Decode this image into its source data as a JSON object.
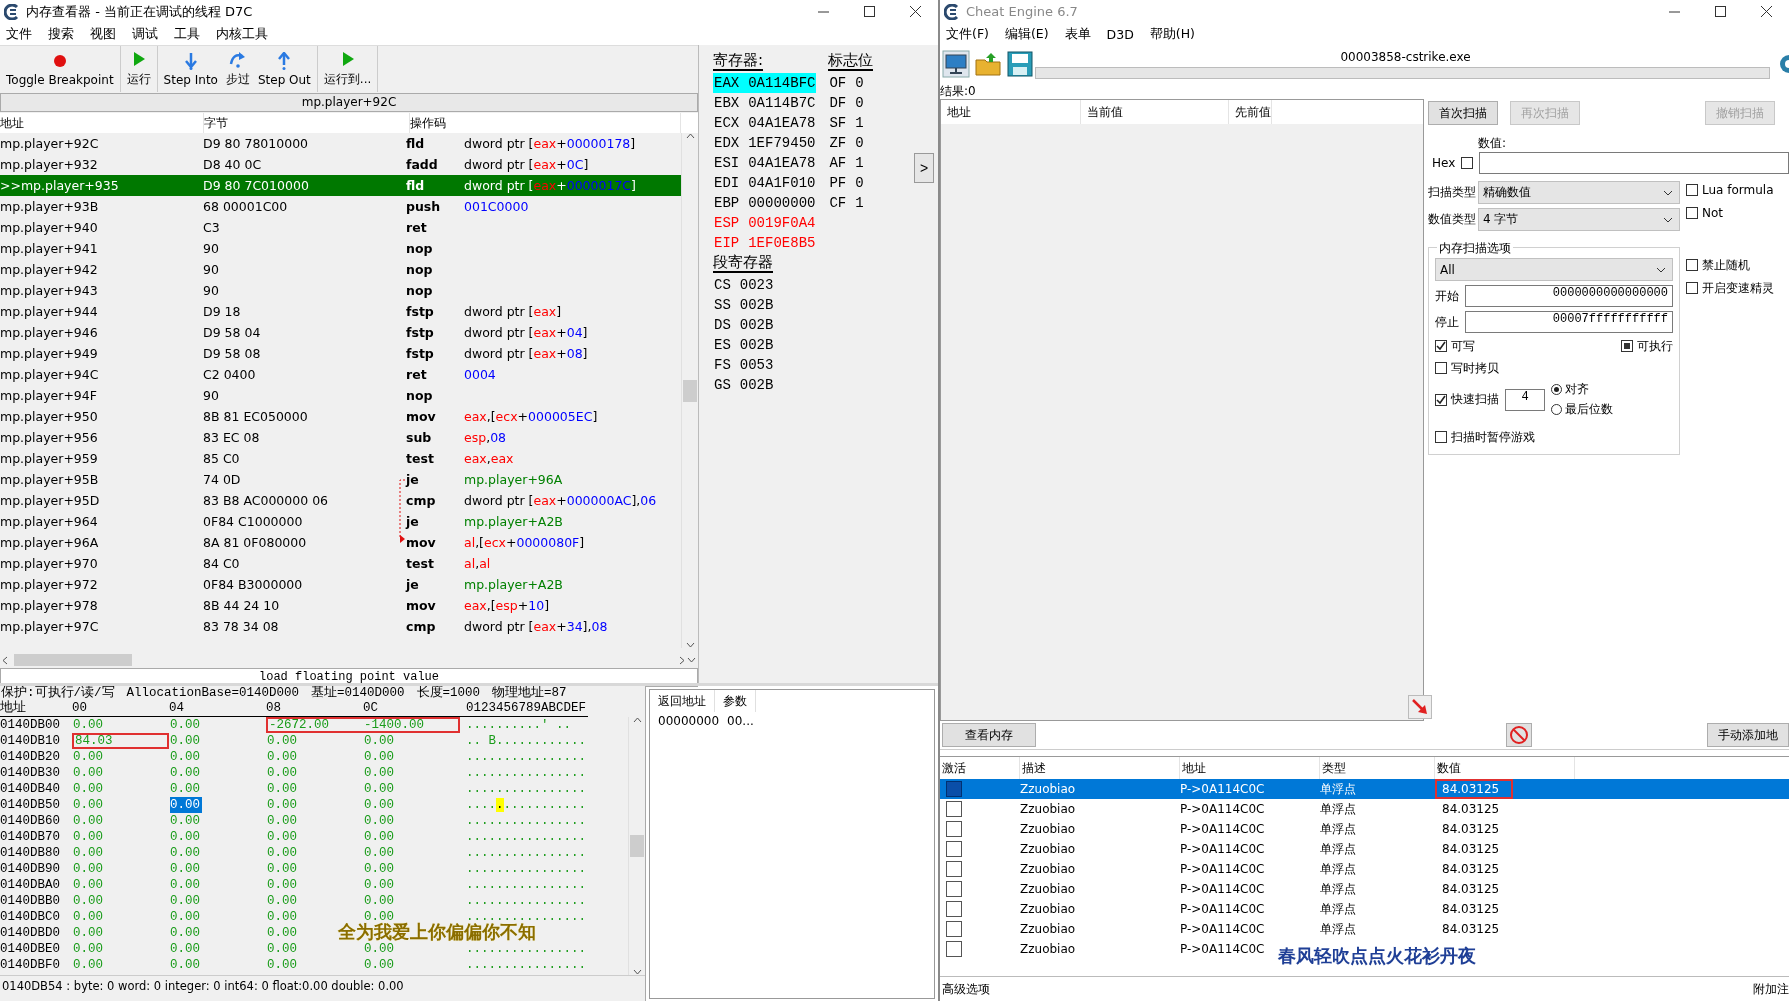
{
  "memory_viewer": {
    "title": "内存查看器 - 当前正在调试的线程 D7C",
    "menu": [
      "文件",
      "搜索",
      "视图",
      "调试",
      "工具",
      "内核工具"
    ],
    "toolbar": [
      [
        {
          "label": "Toggle Breakpoint",
          "kind": "breakpoint"
        }
      ],
      [
        {
          "label": "运行",
          "kind": "run"
        }
      ],
      [
        {
          "label": "Step Into",
          "kind": "step_into"
        },
        {
          "label": "步过",
          "kind": "step_over"
        },
        {
          "label": "Step Out",
          "kind": "step_out"
        }
      ],
      [
        {
          "label": "运行到...",
          "kind": "run"
        }
      ]
    ],
    "address_bar": "mp.player+92C",
    "disassembly": {
      "columns": [
        "地址",
        "字节",
        "操作码"
      ],
      "rows": [
        {
          "address": "mp.player+92C",
          "bytes": "D9 80 78010000",
          "mnemonic": "fld",
          "operand": [
            {
              "text": "dword ptr [",
              "kind": "plain"
            },
            {
              "text": "eax",
              "kind": "register"
            },
            {
              "text": "+",
              "kind": "plain"
            },
            {
              "text": "00000178",
              "kind": "number"
            },
            {
              "text": "]",
              "kind": "plain"
            }
          ],
          "selected": false
        },
        {
          "address": "mp.player+932",
          "bytes": "D8 40 0C",
          "mnemonic": "fadd",
          "operand": [
            {
              "text": "dword ptr [",
              "kind": "plain"
            },
            {
              "text": "eax",
              "kind": "register"
            },
            {
              "text": "+",
              "kind": "plain"
            },
            {
              "text": "0C",
              "kind": "number"
            },
            {
              "text": "]",
              "kind": "plain"
            }
          ],
          "selected": false
        },
        {
          "address": ">>mp.player+935",
          "bytes": "D9 80 7C010000",
          "mnemonic": "fld",
          "operand": [
            {
              "text": "dword ptr [",
              "kind": "plain"
            },
            {
              "text": "eax",
              "kind": "register"
            },
            {
              "text": "+",
              "kind": "plain"
            },
            {
              "text": "0000017C",
              "kind": "number"
            },
            {
              "text": "]",
              "kind": "plain"
            }
          ],
          "selected": true
        },
        {
          "address": "mp.player+93B",
          "bytes": "68 00001C00",
          "mnemonic": "push",
          "operand": [
            {
              "text": "001C0000",
              "kind": "number"
            }
          ],
          "selected": false
        },
        {
          "address": "mp.player+940",
          "bytes": "C3",
          "mnemonic": "ret",
          "operand": [],
          "selected": false
        },
        {
          "address": "mp.player+941",
          "bytes": "90",
          "mnemonic": "nop",
          "operand": [],
          "selected": false
        },
        {
          "address": "mp.player+942",
          "bytes": "90",
          "mnemonic": "nop",
          "operand": [],
          "selected": false
        },
        {
          "address": "mp.player+943",
          "bytes": "90",
          "mnemonic": "nop",
          "operand": [],
          "selected": false
        },
        {
          "address": "mp.player+944",
          "bytes": "D9 18",
          "mnemonic": "fstp",
          "operand": [
            {
              "text": "dword ptr [",
              "kind": "plain"
            },
            {
              "text": "eax",
              "kind": "register"
            },
            {
              "text": "]",
              "kind": "plain"
            }
          ],
          "selected": false
        },
        {
          "address": "mp.player+946",
          "bytes": "D9 58 04",
          "mnemonic": "fstp",
          "operand": [
            {
              "text": "dword ptr [",
              "kind": "plain"
            },
            {
              "text": "eax",
              "kind": "register"
            },
            {
              "text": "+",
              "kind": "plain"
            },
            {
              "text": "04",
              "kind": "number"
            },
            {
              "text": "]",
              "kind": "plain"
            }
          ],
          "selected": false
        },
        {
          "address": "mp.player+949",
          "bytes": "D9 58 08",
          "mnemonic": "fstp",
          "operand": [
            {
              "text": "dword ptr [",
              "kind": "plain"
            },
            {
              "text": "eax",
              "kind": "register"
            },
            {
              "text": "+",
              "kind": "plain"
            },
            {
              "text": "08",
              "kind": "number"
            },
            {
              "text": "]",
              "kind": "plain"
            }
          ],
          "selected": false
        },
        {
          "address": "mp.player+94C",
          "bytes": "C2 0400",
          "mnemonic": "ret",
          "operand": [
            {
              "text": "0004",
              "kind": "number"
            }
          ],
          "selected": false
        },
        {
          "address": "mp.player+94F",
          "bytes": "90",
          "mnemonic": "nop",
          "operand": [],
          "selected": false
        },
        {
          "address": "mp.player+950",
          "bytes": "8B 81 EC050000",
          "mnemonic": "mov",
          "operand": [
            {
              "text": "eax",
              "kind": "register"
            },
            {
              "text": ",[",
              "kind": "plain"
            },
            {
              "text": "ecx",
              "kind": "register"
            },
            {
              "text": "+",
              "kind": "plain"
            },
            {
              "text": "000005EC",
              "kind": "number"
            },
            {
              "text": "]",
              "kind": "plain"
            }
          ],
          "selected": false
        },
        {
          "address": "mp.player+956",
          "bytes": "83 EC 08",
          "mnemonic": "sub",
          "operand": [
            {
              "text": "esp",
              "kind": "register"
            },
            {
              "text": ",",
              "kind": "plain"
            },
            {
              "text": "08",
              "kind": "number"
            }
          ],
          "selected": false
        },
        {
          "address": "mp.player+959",
          "bytes": "85 C0",
          "mnemonic": "test",
          "operand": [
            {
              "text": "eax",
              "kind": "register"
            },
            {
              "text": ",",
              "kind": "plain"
            },
            {
              "text": "eax",
              "kind": "register"
            }
          ],
          "selected": false
        },
        {
          "address": "mp.player+95B",
          "bytes": "74 0D",
          "mnemonic": "je",
          "operand": [
            {
              "text": "mp.player+96A",
              "kind": "address"
            }
          ],
          "selected": false,
          "jump_start": true
        },
        {
          "address": "mp.player+95D",
          "bytes": "83 B8 AC000000 06",
          "mnemonic": "cmp",
          "operand": [
            {
              "text": "dword ptr [",
              "kind": "plain"
            },
            {
              "text": "eax",
              "kind": "register"
            },
            {
              "text": "+",
              "kind": "plain"
            },
            {
              "text": "000000AC",
              "kind": "number"
            },
            {
              "text": "],",
              "kind": "plain"
            },
            {
              "text": "06",
              "kind": "number"
            }
          ],
          "selected": false
        },
        {
          "address": "mp.player+964",
          "bytes": "0F84 C1000000",
          "mnemonic": "je",
          "operand": [
            {
              "text": "mp.player+A2B",
              "kind": "address"
            }
          ],
          "selected": false
        },
        {
          "address": "mp.player+96A",
          "bytes": "8A 81 0F080000",
          "mnemonic": "mov",
          "operand": [
            {
              "text": "al",
              "kind": "register"
            },
            {
              "text": ",[",
              "kind": "plain"
            },
            {
              "text": "ecx",
              "kind": "register"
            },
            {
              "text": "+",
              "kind": "plain"
            },
            {
              "text": "0000080F",
              "kind": "number"
            },
            {
              "text": "]",
              "kind": "plain"
            }
          ],
          "selected": false,
          "jump_end": true
        },
        {
          "address": "mp.player+970",
          "bytes": "84 C0",
          "mnemonic": "test",
          "operand": [
            {
              "text": "al",
              "kind": "register"
            },
            {
              "text": ",",
              "kind": "plain"
            },
            {
              "text": "al",
              "kind": "register"
            }
          ],
          "selected": false
        },
        {
          "address": "mp.player+972",
          "bytes": "0F84 B3000000",
          "mnemonic": "je",
          "operand": [
            {
              "text": "mp.player+A2B",
              "kind": "address"
            }
          ],
          "selected": false
        },
        {
          "address": "mp.player+978",
          "bytes": "8B 44 24 10",
          "mnemonic": "mov",
          "operand": [
            {
              "text": "eax",
              "kind": "register"
            },
            {
              "text": ",[",
              "kind": "plain"
            },
            {
              "text": "esp",
              "kind": "register"
            },
            {
              "text": "+",
              "kind": "plain"
            },
            {
              "text": "10",
              "kind": "number"
            },
            {
              "text": "]",
              "kind": "plain"
            }
          ],
          "selected": false
        },
        {
          "address": "mp.player+97C",
          "bytes": "83 78 34 08",
          "mnemonic": "cmp",
          "operand": [
            {
              "text": "dword ptr [",
              "kind": "plain"
            },
            {
              "text": "eax",
              "kind": "register"
            },
            {
              "text": "+",
              "kind": "plain"
            },
            {
              "text": "34",
              "kind": "number"
            },
            {
              "text": "],",
              "kind": "plain"
            },
            {
              "text": "08",
              "kind": "number"
            }
          ],
          "selected": false
        }
      ]
    },
    "hint": "load floating point value",
    "registers": {
      "title": "寄存器:",
      "flags_title": "标志位",
      "segment_title": "段寄存器",
      "expand_button": ">",
      "general": [
        {
          "name": "EAX",
          "value": "0A114BFC",
          "selected": true,
          "changed": false
        },
        {
          "name": "EBX",
          "value": "0A114B7C",
          "selected": false,
          "changed": false
        },
        {
          "name": "ECX",
          "value": "04A1EA78",
          "selected": false,
          "changed": false
        },
        {
          "name": "EDX",
          "value": "1EF79450",
          "selected": false,
          "changed": false
        },
        {
          "name": "ESI",
          "value": "04A1EA78",
          "selected": false,
          "changed": false
        },
        {
          "name": "EDI",
          "value": "04A1F010",
          "selected": false,
          "changed": false
        },
        {
          "name": "EBP",
          "value": "00000000",
          "selected": false,
          "changed": false
        },
        {
          "name": "ESP",
          "value": "0019F0A4",
          "selected": false,
          "changed": true
        },
        {
          "name": "EIP",
          "value": "1EF0E8B5",
          "selected": false,
          "changed": true
        }
      ],
      "flags": [
        {
          "name": "OF",
          "value": "0"
        },
        {
          "name": "DF",
          "value": "0"
        },
        {
          "name": "SF",
          "value": "1"
        },
        {
          "name": "ZF",
          "value": "0"
        },
        {
          "name": "AF",
          "value": "1"
        },
        {
          "name": "PF",
          "value": "0"
        },
        {
          "name": "CF",
          "value": "1"
        }
      ],
      "segments": [
        {
          "name": "CS",
          "value": "0023"
        },
        {
          "name": "SS",
          "value": "002B"
        },
        {
          "name": "DS",
          "value": "002B"
        },
        {
          "name": "ES",
          "value": "002B"
        },
        {
          "name": "FS",
          "value": "0053"
        },
        {
          "name": "GS",
          "value": "002B"
        }
      ]
    },
    "hex": {
      "info": [
        "保护:可执行/读/写",
        "AllocationBase=0140D000",
        "基址=0140D000",
        "长度=1000",
        "物理地址=87"
      ],
      "columns": [
        "地址",
        "00",
        "04",
        "08",
        "0C",
        "0123456789ABCDEF"
      ],
      "rows": [
        {
          "address": "0140DB00",
          "values": [
            "0.00",
            "0.00",
            "-2672.00",
            "-1400.00"
          ],
          "boxed": [
            false,
            false,
            true,
            true
          ],
          "ascii": "..........' .."
        },
        {
          "address": "0140DB10",
          "values": [
            "84.03",
            "0.00",
            "0.00",
            "0.00"
          ],
          "boxed": [
            true,
            false,
            false,
            false
          ],
          "ascii": ".. B............"
        },
        {
          "address": "0140DB20",
          "values": [
            "0.00",
            "0.00",
            "0.00",
            "0.00"
          ],
          "ascii": "................"
        },
        {
          "address": "0140DB30",
          "values": [
            "0.00",
            "0.00",
            "0.00",
            "0.00"
          ],
          "ascii": "................"
        },
        {
          "address": "0140DB40",
          "values": [
            "0.00",
            "0.00",
            "0.00",
            "0.00"
          ],
          "ascii": "................"
        },
        {
          "address": "0140DB50",
          "values": [
            "0.00",
            "0.00",
            "0.00",
            "0.00"
          ],
          "selected": [
            false,
            true,
            false,
            false
          ],
          "ascii": [
            {
              "text": "....",
              "marked": false
            },
            {
              "text": ".",
              "marked": true
            },
            {
              "text": "...........",
              "marked": false
            }
          ]
        },
        {
          "address": "0140DB60",
          "values": [
            "0.00",
            "0.00",
            "0.00",
            "0.00"
          ],
          "ascii": "................"
        },
        {
          "address": "0140DB70",
          "values": [
            "0.00",
            "0.00",
            "0.00",
            "0.00"
          ],
          "ascii": "................"
        },
        {
          "address": "0140DB80",
          "values": [
            "0.00",
            "0.00",
            "0.00",
            "0.00"
          ],
          "ascii": "................"
        },
        {
          "address": "0140DB90",
          "values": [
            "0.00",
            "0.00",
            "0.00",
            "0.00"
          ],
          "ascii": "................"
        },
        {
          "address": "0140DBA0",
          "values": [
            "0.00",
            "0.00",
            "0.00",
            "0.00"
          ],
          "ascii": "................"
        },
        {
          "address": "0140DBB0",
          "values": [
            "0.00",
            "0.00",
            "0.00",
            "0.00"
          ],
          "ascii": "................"
        },
        {
          "address": "0140DBC0",
          "values": [
            "0.00",
            "0.00",
            "0.00",
            "0.00"
          ],
          "ascii": "................"
        },
        {
          "address": "0140DBD0",
          "values": [
            "0.00",
            "0.00",
            "0.00"
          ]
        },
        {
          "address": "0140DBE0",
          "values": [
            "0.00",
            "0.00",
            "0.00",
            "0.00"
          ],
          "ascii": "................"
        },
        {
          "address": "0140DBF0",
          "values": [
            "0.00",
            "0.00",
            "0.00",
            "0.00"
          ],
          "ascii": "................"
        }
      ],
      "status": "0140DB54 : byte: 0 word: 0 integer: 0 int64: 0 float:0.00 double: 0.00"
    },
    "stack": {
      "columns": [
        "返回地址",
        "参数"
      ],
      "rows": [
        [
          "00000000",
          "00..."
        ]
      ]
    }
  },
  "cheat_engine": {
    "title": "Cheat Engine 6.7",
    "menu": [
      "文件(F)",
      "编辑(E)",
      "表单",
      "D3D",
      "帮助(H)"
    ],
    "process": "00003858-cstrike.exe",
    "progress": {
      "level": 0
    },
    "results_label": "结果:0",
    "results_columns": [
      "地址",
      "当前值",
      "先前值"
    ],
    "scan_buttons": [
      {
        "label": "首次扫描",
        "disabled": false
      },
      {
        "label": "再次扫描",
        "disabled": true
      },
      {
        "label": "撤销扫描",
        "disabled": true
      }
    ],
    "value_label": "数值:",
    "hex": {
      "label": "Hex",
      "checked": false
    },
    "scan_type": {
      "label": "扫描类型",
      "value": "精确数值"
    },
    "value_type": {
      "label": "数值类型",
      "value": "4 字节"
    },
    "options_top": [
      {
        "label": "Lua formula",
        "checked": false
      },
      {
        "label": "Not",
        "checked": false
      }
    ],
    "options_bottom": [
      {
        "label": "禁止随机",
        "checked": false
      },
      {
        "label": "开启变速精灵",
        "checked": false
      }
    ],
    "memory_options": {
      "title": "内存扫描选项",
      "region": "All",
      "start": {
        "label": "开始",
        "value": "0000000000000000"
      },
      "stop": {
        "label": "停止",
        "value": "00007fffffffffff"
      },
      "writable": {
        "label": "可写",
        "checked": true
      },
      "executable": {
        "label": "可执行",
        "indeterminate": true
      },
      "copy_on_write": {
        "label": "写时拷贝",
        "checked": false
      },
      "fast_scan": {
        "label": "快速扫描",
        "checked": true,
        "value": "4"
      },
      "alignment": [
        {
          "label": "对齐",
          "selected": true
        },
        {
          "label": "最后位数",
          "selected": false
        }
      ],
      "pause": {
        "label": "扫描时暂停游戏",
        "checked": false
      }
    },
    "view_memory": "查看内存",
    "add_address": "手动添加地",
    "table": {
      "columns": [
        "激活",
        "描述",
        "地址",
        "类型",
        "数值"
      ],
      "rows": [
        {
          "active": false,
          "description": "Zzuobiao",
          "address": "P->0A114C0C",
          "type": "单浮点",
          "value": "84.03125",
          "selected": true,
          "boxed": true
        },
        {
          "active": false,
          "description": "Zzuobiao",
          "address": "P->0A114C0C",
          "type": "单浮点",
          "value": "84.03125",
          "selected": false,
          "boxed": false
        },
        {
          "active": false,
          "description": "Zzuobiao",
          "address": "P->0A114C0C",
          "type": "单浮点",
          "value": "84.03125",
          "selected": false,
          "boxed": false
        },
        {
          "active": false,
          "description": "Zzuobiao",
          "address": "P->0A114C0C",
          "type": "单浮点",
          "value": "84.03125",
          "selected": false,
          "boxed": false
        },
        {
          "active": false,
          "description": "Zzuobiao",
          "address": "P->0A114C0C",
          "type": "单浮点",
          "value": "84.03125",
          "selected": false,
          "boxed": false
        },
        {
          "active": false,
          "description": "Zzuobiao",
          "address": "P->0A114C0C",
          "type": "单浮点",
          "value": "84.03125",
          "selected": false,
          "boxed": false
        },
        {
          "active": false,
          "description": "Zzuobiao",
          "address": "P->0A114C0C",
          "type": "单浮点",
          "value": "84.03125",
          "selected": false,
          "boxed": false
        },
        {
          "active": false,
          "description": "Zzuobiao",
          "address": "P->0A114C0C",
          "type": "单浮点",
          "value": "84.03125",
          "selected": false,
          "boxed": false
        },
        {
          "active": false,
          "description": "Zzuobiao",
          "address": "P->0A114C0C",
          "selected": false
        }
      ]
    },
    "advanced": "高级选项",
    "comments": "附加注"
  },
  "lyrics": [
    {
      "text": "全为我爱上你偏偏你不知",
      "kind": "warm"
    },
    {
      "text": "春风轻吹点点火花衫丹夜",
      "kind": "cool"
    }
  ]
}
